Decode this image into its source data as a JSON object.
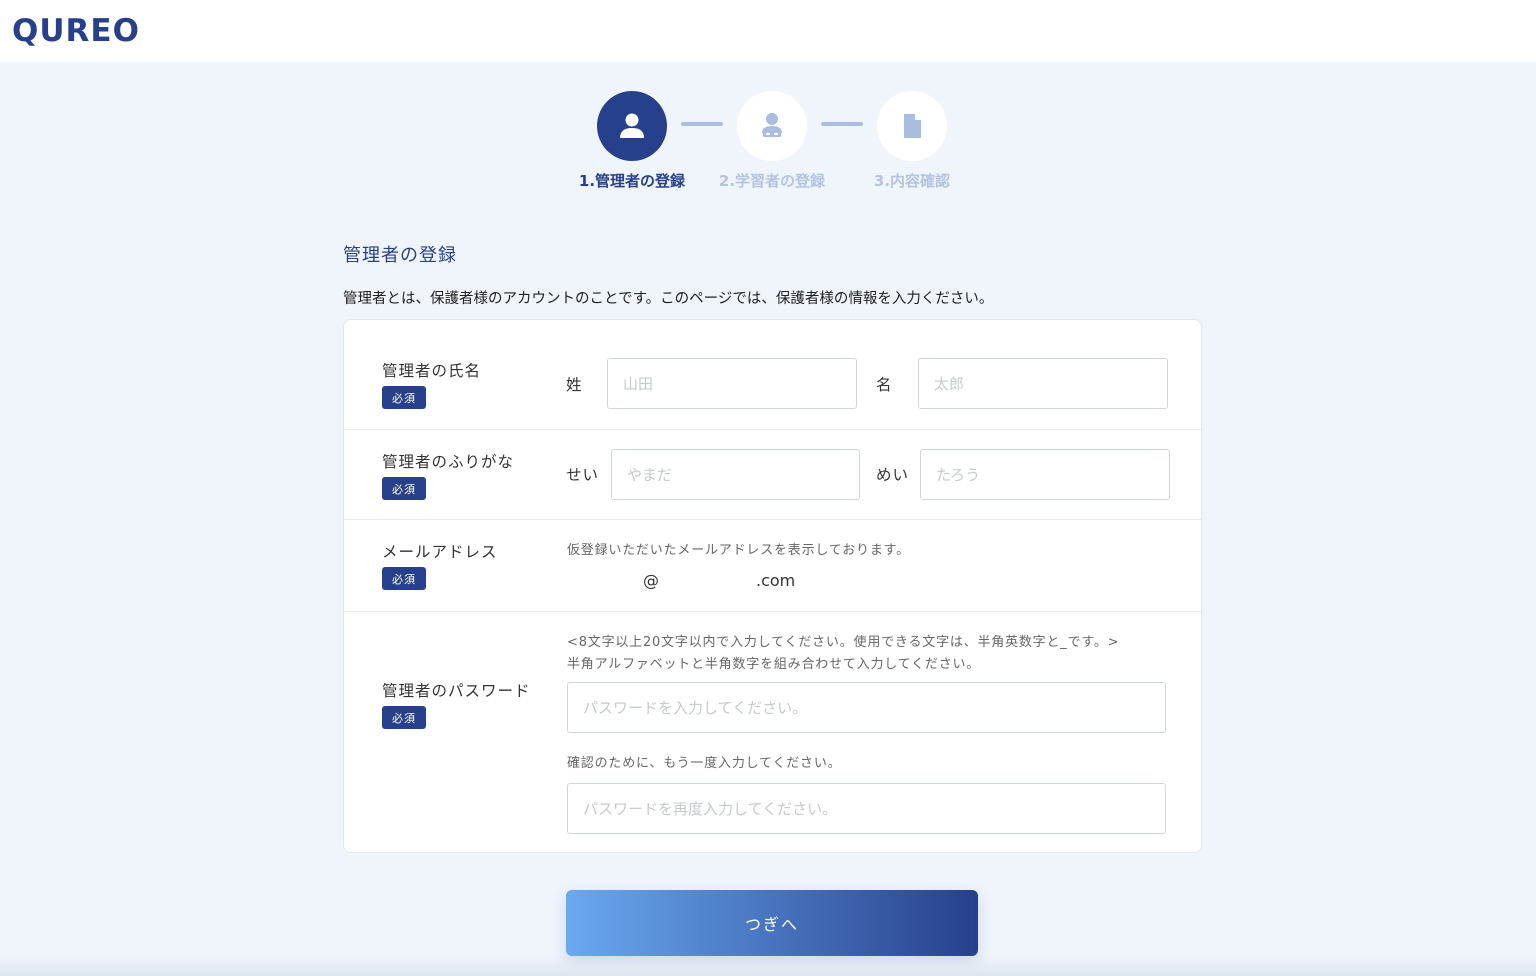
{
  "brand": {
    "logo_text": "QUREO"
  },
  "stepper": {
    "steps": [
      {
        "label": "1.管理者の登録",
        "icon": "user-icon",
        "state": "active"
      },
      {
        "label": "2.学習者の登録",
        "icon": "student-icon",
        "state": "inactive"
      },
      {
        "label": "3.内容確認",
        "icon": "document-icon",
        "state": "inactive"
      }
    ]
  },
  "section": {
    "title": "管理者の登録",
    "description": "管理者とは、保護者様のアカウントのことです。このページでは、保護者様の情報を入力ください。"
  },
  "form": {
    "required_badge": "必須",
    "name": {
      "label": "管理者の氏名",
      "last_label": "姓",
      "last_placeholder": "山田",
      "first_label": "名",
      "first_placeholder": "太郎"
    },
    "kana": {
      "label": "管理者のふりがな",
      "last_label": "せい",
      "last_placeholder": "やまだ",
      "first_label": "めい",
      "first_placeholder": "たろう"
    },
    "email": {
      "label": "メールアドレス",
      "help": "仮登録いただいたメールアドレスを表示しております。",
      "at": "@",
      "domain_suffix": ".com"
    },
    "password": {
      "label": "管理者のパスワード",
      "rule_line1": "<8文字以上20文字以内で入力してください。使用できる文字は、半角英数字と_です。>",
      "rule_line2": "半角アルファベットと半角数字を組み合わせて入力してください。",
      "placeholder": "パスワードを入力してください。",
      "confirm_help": "確認のために、もう一度入力してください。",
      "confirm_placeholder": "パスワードを再度入力してください。"
    }
  },
  "actions": {
    "next_label": "つぎへ"
  },
  "colors": {
    "brand": "#27408b",
    "page_bg": "#f0f5fc",
    "inactive_step": "#b3c4e2"
  }
}
